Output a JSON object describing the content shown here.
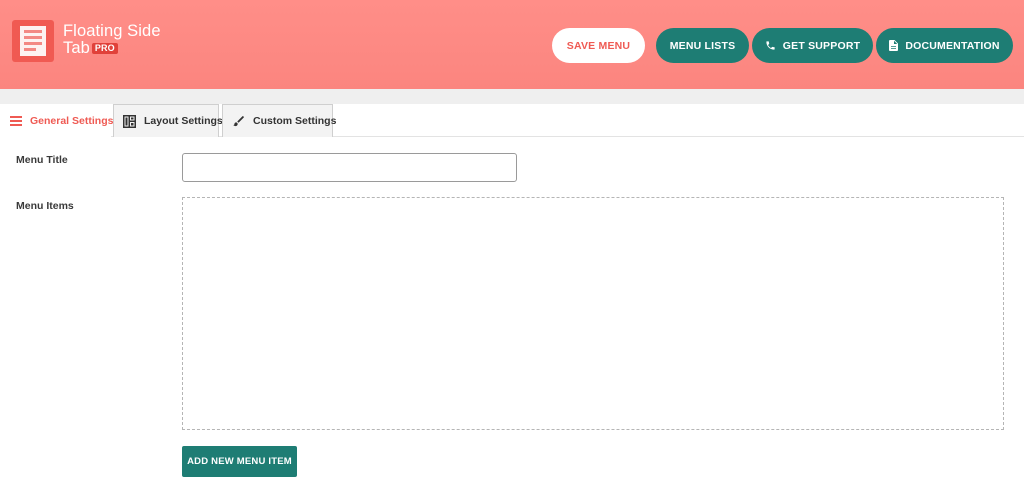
{
  "brand": {
    "name": "Floating Side Tab",
    "badge": "PRO",
    "icon": "floating-tab-logo"
  },
  "header": {
    "save_label": "SAVE MENU",
    "menu_lists_label": "MENU LISTS",
    "support_label": "GET SUPPORT",
    "support_icon": "phone-icon",
    "docs_label": "DOCUMENTATION",
    "docs_icon": "document-icon"
  },
  "tabs": [
    {
      "label": "General Settings",
      "icon": "hamburger-icon",
      "active": true
    },
    {
      "label": "Layout Settings",
      "icon": "layout-grid-icon",
      "active": false
    },
    {
      "label": "Custom Settings",
      "icon": "paintbrush-icon",
      "active": false
    }
  ],
  "form": {
    "menu_title_label": "Menu Title",
    "menu_title_value": "",
    "menu_items_label": "Menu Items",
    "add_item_label": "ADD NEW MENU ITEM"
  },
  "colors": {
    "header_bg": "#fb857f",
    "accent": "#ef5a53",
    "teal": "#1e7d74"
  }
}
